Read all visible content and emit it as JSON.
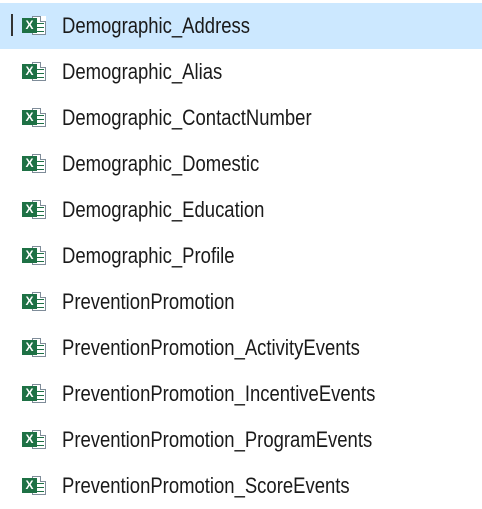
{
  "files": [
    {
      "name": "Demographic_Address",
      "icon": "excel-file-icon",
      "selected": true
    },
    {
      "name": "Demographic_Alias",
      "icon": "excel-file-icon",
      "selected": false
    },
    {
      "name": "Demographic_ContactNumber",
      "icon": "excel-file-icon",
      "selected": false
    },
    {
      "name": "Demographic_Domestic",
      "icon": "excel-file-icon",
      "selected": false
    },
    {
      "name": "Demographic_Education",
      "icon": "excel-file-icon",
      "selected": false
    },
    {
      "name": "Demographic_Profile",
      "icon": "excel-file-icon",
      "selected": false
    },
    {
      "name": "PreventionPromotion",
      "icon": "excel-file-icon",
      "selected": false
    },
    {
      "name": "PreventionPromotion_ActivityEvents",
      "icon": "excel-file-icon",
      "selected": false
    },
    {
      "name": "PreventionPromotion_IncentiveEvents",
      "icon": "excel-file-icon",
      "selected": false
    },
    {
      "name": "PreventionPromotion_ProgramEvents",
      "icon": "excel-file-icon",
      "selected": false
    },
    {
      "name": "PreventionPromotion_ScoreEvents",
      "icon": "excel-file-icon",
      "selected": false
    }
  ],
  "icon_badge_letter": "X",
  "colors": {
    "selection": "#cce8ff",
    "excel_green": "#1e7145",
    "text": "#1a1a1a"
  }
}
